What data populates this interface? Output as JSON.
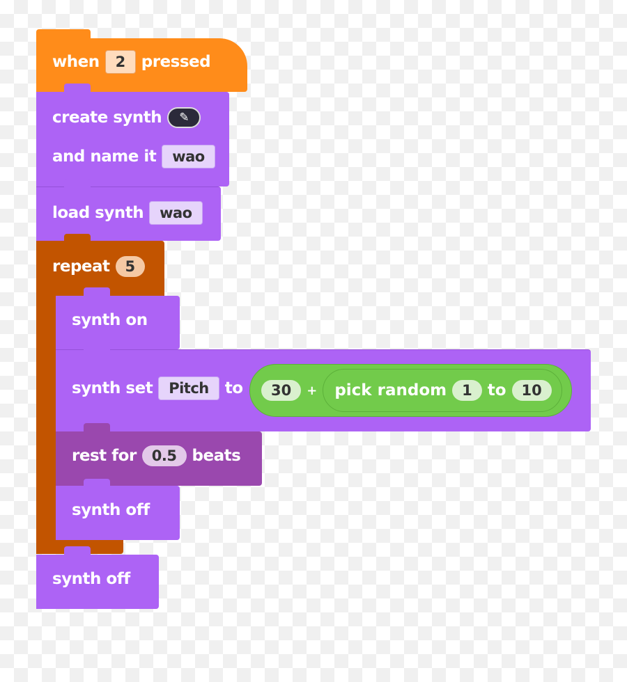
{
  "colors": {
    "event": "#ff8c1a",
    "synth": "#ad63f5",
    "control": "#c25400",
    "rest": "#9a48ae",
    "operator": "#72cb4b"
  },
  "hat": {
    "when": "when",
    "key": "2",
    "pressed": "pressed"
  },
  "create": {
    "label": "create synth",
    "icon": "pencil-icon",
    "name_label": "and name it",
    "name": "wao"
  },
  "load": {
    "label": "load synth",
    "name": "wao"
  },
  "repeat": {
    "label": "repeat",
    "count": "5"
  },
  "synth_on": {
    "label": "synth on"
  },
  "synth_set": {
    "label": "synth set",
    "param": "Pitch",
    "to": "to",
    "a": "30",
    "plus": "+",
    "random_label": "pick random",
    "from": "1",
    "to2": "to",
    "max": "10"
  },
  "rest": {
    "label": "rest for",
    "beats": "0.5",
    "unit": "beats"
  },
  "synth_off_inner": {
    "label": "synth off"
  },
  "synth_off_outer": {
    "label": "synth off"
  }
}
